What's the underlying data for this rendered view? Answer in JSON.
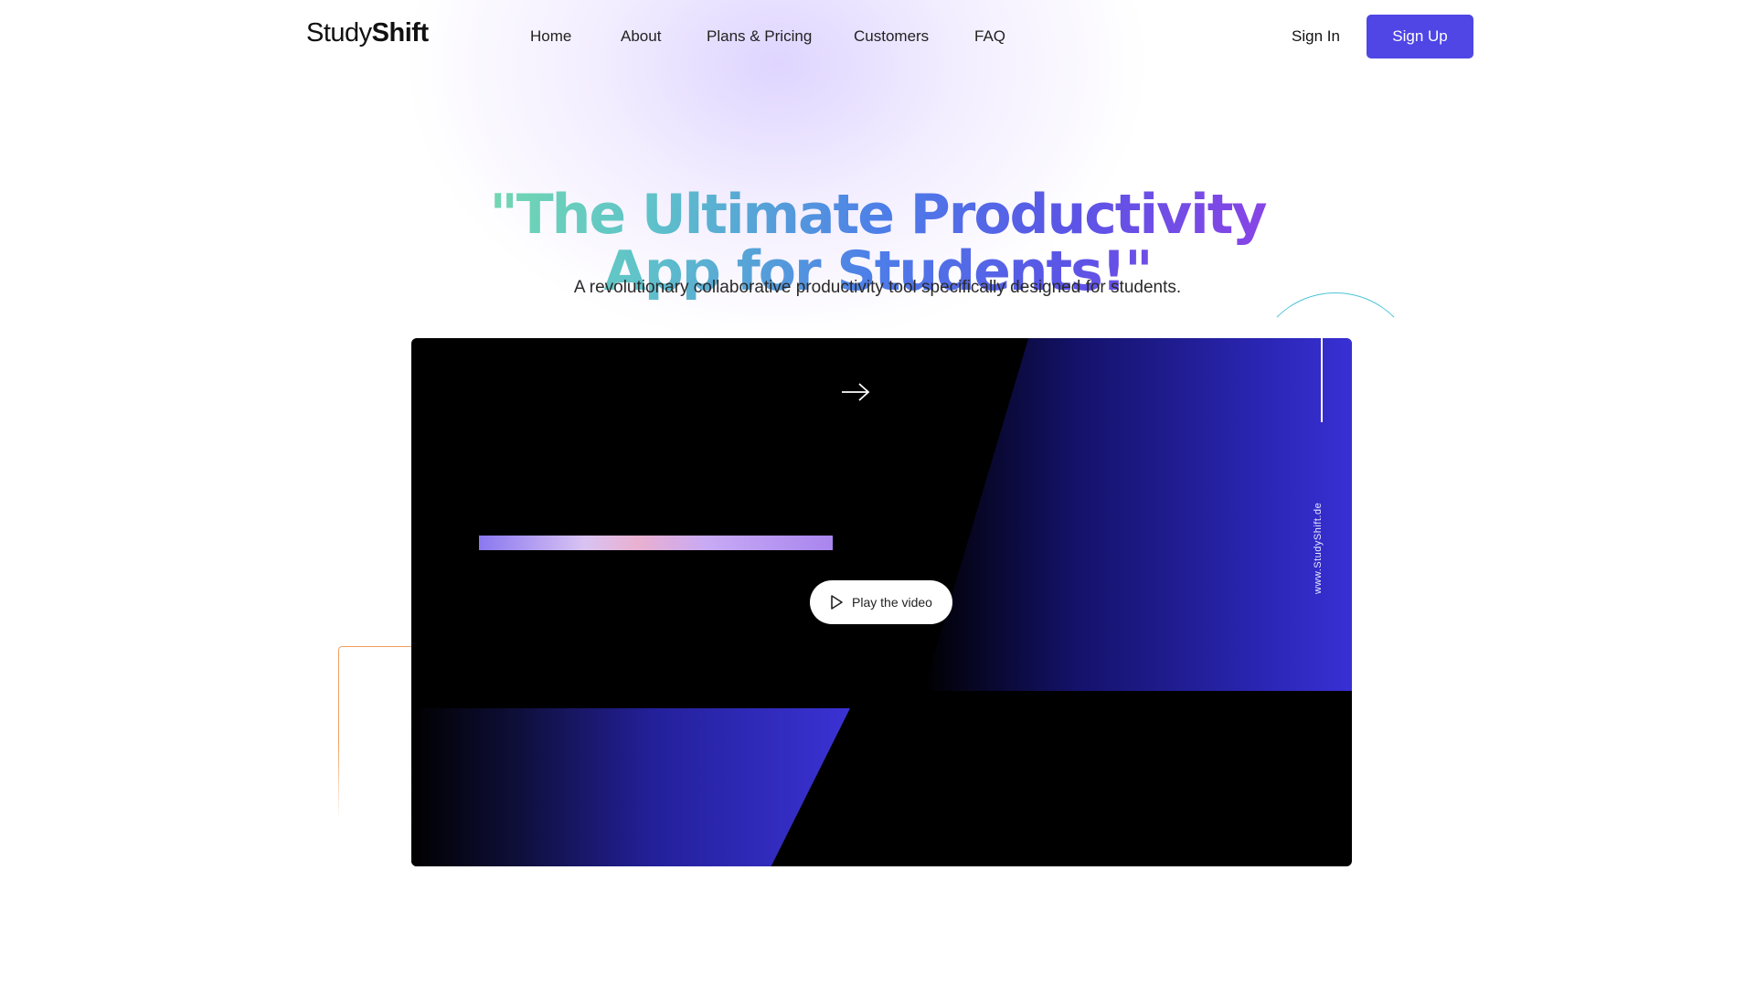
{
  "header": {
    "logo": {
      "part1": "Study",
      "part2": "Shift"
    },
    "nav": [
      "Home",
      "About",
      "Plans & Pricing",
      "Customers",
      "FAQ"
    ],
    "signin_label": "Sign In",
    "signup_label": "Sign Up"
  },
  "hero": {
    "title_line1": "\"The Ultimate Productivity",
    "title_line2": "App for Students!\"",
    "subtitle": "A revolutionary collaborative productivity tool specifically designed for students."
  },
  "video": {
    "play_label": "Play the video",
    "watermark_url": "www.StudyShift.de"
  },
  "colors": {
    "accent": "#4f46e5",
    "title_gradient": [
      "#7be0a7",
      "#5fc3c9",
      "#4d7ee8",
      "#9b3ee6"
    ],
    "panel_blue": "#2c27b8"
  },
  "icons": {
    "arrow": "arrow-right-icon",
    "play": "play-icon"
  }
}
